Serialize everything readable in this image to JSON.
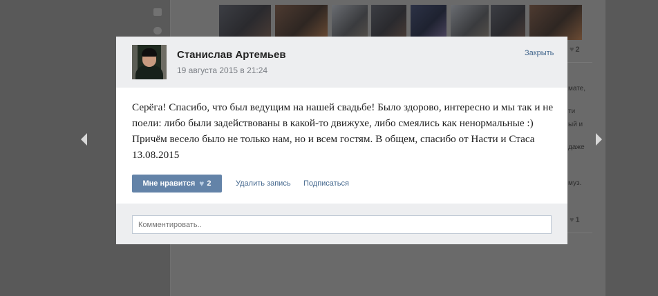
{
  "background": {
    "right_snippets": [
      "мате,",
      "ти",
      "ый и",
      "даже",
      "муз."
    ],
    "like_counts": [
      "2",
      "1"
    ]
  },
  "modal": {
    "author_name": "Станислав Артемьев",
    "date": "19 августа 2015 в 21:24",
    "close_label": "Закрыть",
    "post_text": "Серёга! Спасибо, что был ведущим на нашей свадьбе! Было здорово, интересно и мы так и не поели: либо были задействованы в какой-то движухе, либо смеялись как ненормальные :) Причём весело было не только нам, но и всем гостям. В общем, спасибо от Насти и Стаса 13.08.2015",
    "like_label": "Мне нравится",
    "like_count": "2",
    "delete_label": "Удалить запись",
    "subscribe_label": "Подписаться",
    "comment_placeholder": "Комментировать.."
  },
  "icons": {
    "heart": "heart-icon",
    "prev": "arrow-left-icon",
    "next": "arrow-right-icon"
  }
}
